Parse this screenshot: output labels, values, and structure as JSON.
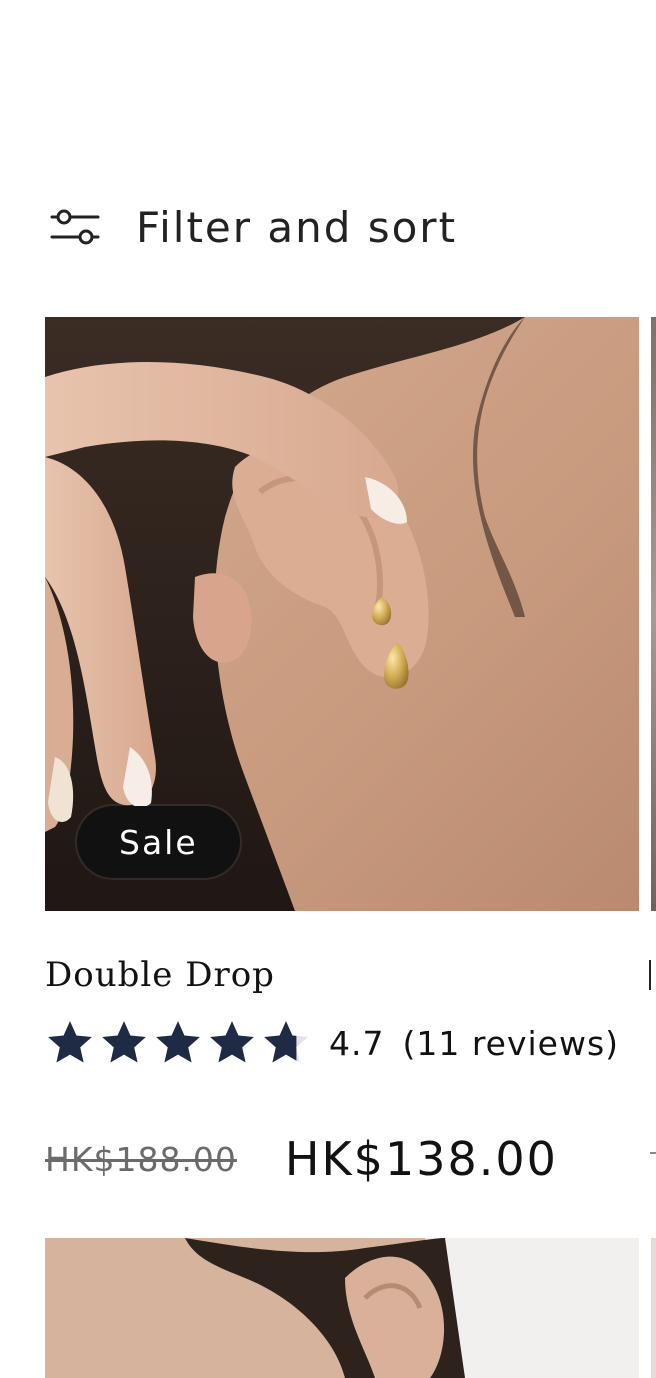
{
  "toolbar": {
    "filter_label": "Filter and sort",
    "filter_icon": "sliders-icon"
  },
  "products": [
    {
      "title": "Double Drop",
      "badge": "Sale",
      "rating": {
        "value": 4.7,
        "max": 5,
        "value_label": "4.7",
        "count_label": "(11 reviews)",
        "star_color": "#1f2a44"
      },
      "price": {
        "compare_at": "HK$188.00",
        "sale": "HK$138.00"
      },
      "image": "ear-with-gold-drop-earrings"
    },
    {
      "image": "ear-closeup-next-product"
    }
  ],
  "colors": {
    "badge_bg": "#111111",
    "text": "#121212",
    "muted": "#6b6b6b",
    "star": "#1f2a44"
  }
}
